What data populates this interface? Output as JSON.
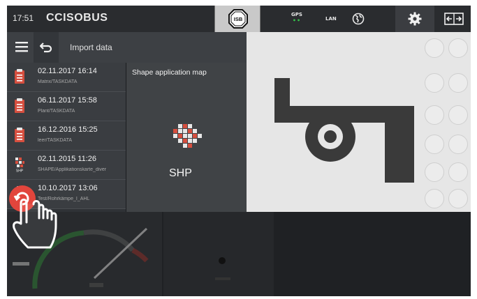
{
  "statusbar": {
    "time": "17:51",
    "logo": "CCISOBUS",
    "isb_label": "ISB",
    "gps_label": "GPS",
    "gps_dots": "••",
    "lan_label": "LAN",
    "icons": [
      "isb-icon",
      "globe-icon",
      "gear-icon",
      "switch-screen-icon"
    ],
    "gps_dot_color": "#35c24a"
  },
  "dialog": {
    "title": "Import data",
    "items": [
      {
        "date": "02.11.2017 16:14",
        "path": "Matrix/TASKDATA",
        "icon": "task-file-icon"
      },
      {
        "date": "06.11.2017 15:58",
        "path": "Plant/TASKDATA",
        "icon": "task-file-icon"
      },
      {
        "date": "16.12.2016 15:25",
        "path": "leer/TASKDATA",
        "icon": "task-file-icon"
      },
      {
        "date": "02.11.2015 11:26",
        "path": "SHAPE/Applikationskarte_diver",
        "icon": "shp-file-icon"
      },
      {
        "date": "10.10.2017 13:06",
        "path": "Test/Rohrkämpe_I_AHL",
        "icon": "task-file-icon"
      }
    ],
    "detail": {
      "title": "Shape application map",
      "shp_label": "SHP"
    }
  },
  "colors": {
    "accent_red": "#e2453c",
    "icon_red": "#d64f3f"
  }
}
